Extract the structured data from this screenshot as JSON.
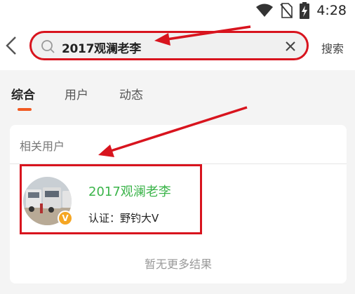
{
  "status_bar": {
    "time": "4:28",
    "icons": [
      "wifi-icon",
      "no-sim-icon",
      "battery-charging-icon"
    ]
  },
  "search": {
    "query": "2017观澜老李",
    "submit_label": "搜索"
  },
  "tabs": [
    {
      "label": "综合",
      "active": true
    },
    {
      "label": "用户",
      "active": false
    },
    {
      "label": "动态",
      "active": false
    }
  ],
  "results": {
    "section_title": "相关用户",
    "users": [
      {
        "name": "2017观澜老李",
        "certification": "认证：野钓大V",
        "badge": "V"
      }
    ],
    "footer": "暂无更多结果"
  },
  "colors": {
    "accent": "#f15a22",
    "username": "#3bb44a",
    "annotation": "#d8141e",
    "badge": "#f5a623"
  }
}
